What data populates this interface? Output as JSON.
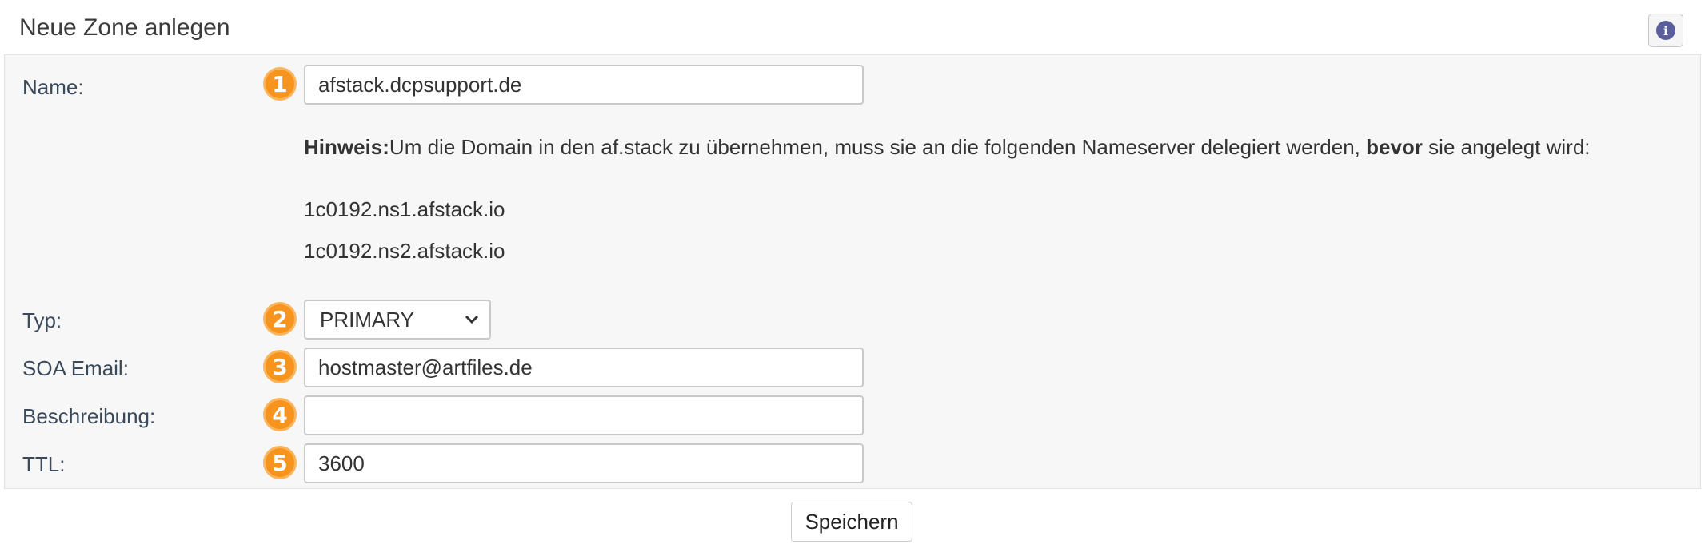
{
  "header": {
    "title": "Neue Zone anlegen",
    "info_icon": "info-icon"
  },
  "form": {
    "name": {
      "label": "Name:",
      "value": "afstack.dcpsupport.de",
      "step": "1"
    },
    "hint": {
      "prefix_bold": "Hinweis:",
      "text": "Um die Domain in den af.stack zu übernehmen, muss sie an die folgenden Nameserver delegiert werden, ",
      "bold_word": "bevor",
      "suffix": " sie angelegt wird:"
    },
    "nameservers": [
      "1c0192.ns1.afstack.io",
      "1c0192.ns2.afstack.io"
    ],
    "type": {
      "label": "Typ:",
      "value": "PRIMARY",
      "step": "2"
    },
    "soa_email": {
      "label": "SOA Email:",
      "value": "hostmaster@artfiles.de",
      "step": "3"
    },
    "description": {
      "label": "Beschreibung:",
      "value": "",
      "step": "4"
    },
    "ttl": {
      "label": "TTL:",
      "value": "3600",
      "step": "5"
    }
  },
  "actions": {
    "save_label": "Speichern"
  },
  "colors": {
    "badge": "#f7941d",
    "info_icon": "#5a5f9a"
  }
}
